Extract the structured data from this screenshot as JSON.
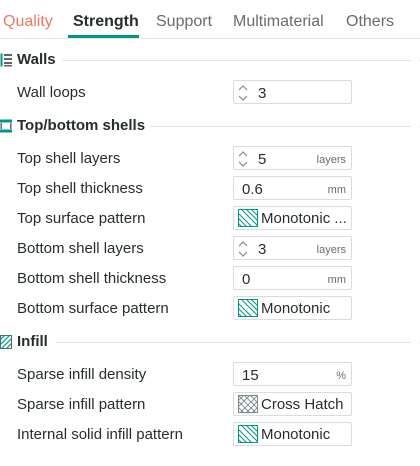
{
  "tabs": [
    {
      "label": "Quality"
    },
    {
      "label": "Strength"
    },
    {
      "label": "Support"
    },
    {
      "label": "Multimaterial"
    },
    {
      "label": "Others"
    }
  ],
  "colors": {
    "accent": "#009688",
    "tab_quality": "#e97c5e"
  },
  "sections": {
    "walls": {
      "title": "Walls",
      "wall_loops": {
        "label": "Wall loops",
        "value": "3"
      }
    },
    "top_bottom": {
      "title": "Top/bottom shells",
      "top_shell_layers": {
        "label": "Top shell layers",
        "value": "5",
        "unit": "layers"
      },
      "top_shell_thickness": {
        "label": "Top shell thickness",
        "value": "0.6",
        "unit": "mm"
      },
      "top_surface_pattern": {
        "label": "Top surface pattern",
        "value": "Monotonic ...",
        "icon": "monotonic-pattern-icon"
      },
      "bottom_shell_layers": {
        "label": "Bottom shell layers",
        "value": "3",
        "unit": "layers"
      },
      "bottom_shell_thickness": {
        "label": "Bottom shell thickness",
        "value": "0",
        "unit": "mm"
      },
      "bottom_surface_pattern": {
        "label": "Bottom surface pattern",
        "value": "Monotonic",
        "icon": "monotonic-pattern-icon"
      }
    },
    "infill": {
      "title": "Infill",
      "sparse_infill_density": {
        "label": "Sparse infill density",
        "value": "15",
        "unit": "%"
      },
      "sparse_infill_pattern": {
        "label": "Sparse infill pattern",
        "value": "Cross Hatch",
        "icon": "cross-hatch-pattern-icon"
      },
      "internal_solid_infill_pattern": {
        "label": "Internal solid infill pattern",
        "value": "Monotonic",
        "icon": "monotonic-pattern-icon"
      }
    }
  }
}
